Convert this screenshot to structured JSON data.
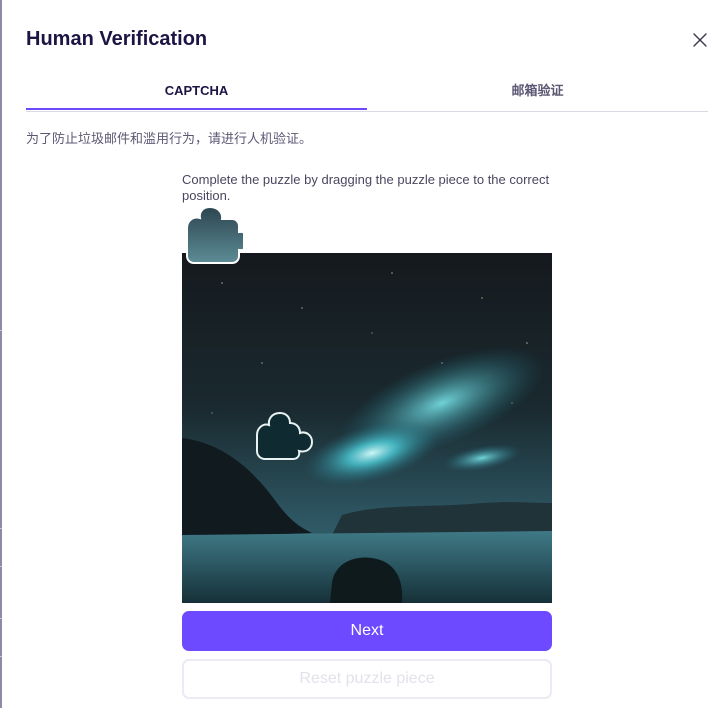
{
  "dialog": {
    "title": "Human Verification",
    "close_icon": "close-icon"
  },
  "tabs": [
    {
      "label": "CAPTCHA",
      "active": true
    },
    {
      "label": "邮箱验证",
      "active": false
    }
  ],
  "description": "为了防止垃圾邮件和滥用行为，请进行人机验证。",
  "captcha": {
    "instruction": "Complete the puzzle by dragging the puzzle piece to the correct position.",
    "next_label": "Next",
    "reset_label": "Reset puzzle piece"
  },
  "colors": {
    "accent": "#6d4aff",
    "title": "#1c1544",
    "muted_text": "#5c5874"
  }
}
